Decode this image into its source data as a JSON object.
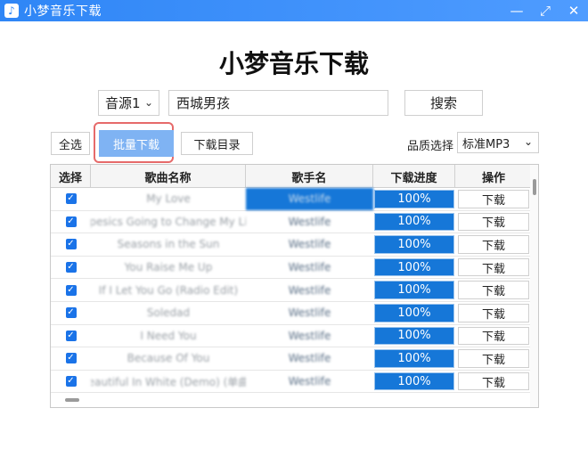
{
  "window": {
    "title": "小梦音乐下载",
    "app_icon": "music-note-icon",
    "controls": [
      {
        "name": "minimize-button",
        "glyph": "—"
      },
      {
        "name": "maximize-button",
        "glyph": "⤢"
      },
      {
        "name": "close-button",
        "glyph": "✕"
      }
    ]
  },
  "header": {
    "title": "小梦音乐下载"
  },
  "search": {
    "source_value": "音源1",
    "query": "西城男孩",
    "button_label": "搜索"
  },
  "toolbar": {
    "select_all_label": "全选",
    "batch_download_label": "批量下载",
    "download_dir_label": "下载目录",
    "quality_label": "品质选择",
    "quality_value": "标准MP3"
  },
  "table": {
    "columns": [
      "选择",
      "歌曲名称",
      "歌手名",
      "下载进度",
      "操作"
    ],
    "rows": [
      {
        "checked": true,
        "song": "My Love",
        "artist": "Westlife",
        "progress": "100%",
        "action": "下载",
        "artist_highlight": true
      },
      {
        "checked": true,
        "song": "pesics Going to Change My Li",
        "artist": "Westlife",
        "progress": "100%",
        "action": "下载",
        "artist_highlight": false
      },
      {
        "checked": true,
        "song": "Seasons in the Sun",
        "artist": "Westlife",
        "progress": "100%",
        "action": "下载",
        "artist_highlight": false
      },
      {
        "checked": true,
        "song": "You Raise Me Up",
        "artist": "Westlife",
        "progress": "100%",
        "action": "下载",
        "artist_highlight": false
      },
      {
        "checked": true,
        "song": "If I Let You Go (Radio Edit)",
        "artist": "Westlife",
        "progress": "100%",
        "action": "下载",
        "artist_highlight": false
      },
      {
        "checked": true,
        "song": "Soledad",
        "artist": "Westlife",
        "progress": "100%",
        "action": "下载",
        "artist_highlight": false
      },
      {
        "checked": true,
        "song": "I Need You",
        "artist": "Westlife",
        "progress": "100%",
        "action": "下载",
        "artist_highlight": false
      },
      {
        "checked": true,
        "song": "Because Of You",
        "artist": "Westlife",
        "progress": "100%",
        "action": "下载",
        "artist_highlight": false
      },
      {
        "checked": true,
        "song": "eautiful In White (Demo) (单曲",
        "artist": "Westlife",
        "progress": "100%",
        "action": "下载",
        "artist_highlight": false
      }
    ]
  },
  "colors": {
    "titlebar": "#2f86f6",
    "accent": "#1677d8",
    "batch_button": "#7fb3f3",
    "highlight_border": "#e66a6a"
  }
}
